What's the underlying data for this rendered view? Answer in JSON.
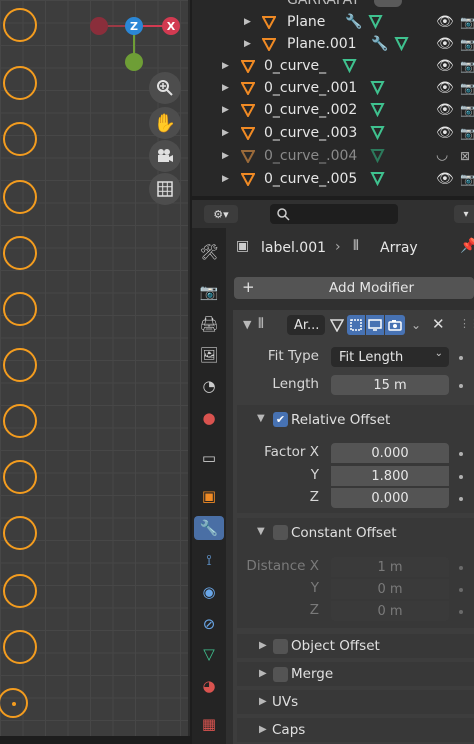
{
  "viewport": {
    "gizmo": {
      "x_label": "X",
      "z_label": "Z"
    },
    "nav_buttons": [
      "zoom-icon",
      "hand-pan-icon",
      "camera-icon",
      "grid-icon"
    ]
  },
  "outliner": {
    "rows": [
      {
        "name": "GARRAFAT",
        "dim": false
      },
      {
        "name": "Plane",
        "dim": false
      },
      {
        "name": "Plane.001",
        "dim": false
      },
      {
        "name": "0_curve_",
        "dim": false
      },
      {
        "name": "0_curve_.001",
        "dim": false
      },
      {
        "name": "0_curve_.002",
        "dim": false
      },
      {
        "name": "0_curve_.003",
        "dim": false
      },
      {
        "name": "0_curve_.004",
        "dim": true
      },
      {
        "name": "0_curve_.005",
        "dim": false
      }
    ]
  },
  "properties": {
    "breadcrumb": {
      "object": "label.001",
      "modifier": "Array"
    },
    "add_modifier": "Add Modifier",
    "modifier": {
      "name": "Ar...",
      "fit_type_label": "Fit Type",
      "fit_type_value": "Fit Length",
      "length_label": "Length",
      "length_value": "15 m",
      "relative_offset": {
        "label": "Relative Offset",
        "enabled": true,
        "factor_x_label": "Factor X",
        "factor_x": "0.000",
        "y_label": "Y",
        "y": "1.800",
        "z_label": "Z",
        "z": "0.000"
      },
      "constant_offset": {
        "label": "Constant Offset",
        "enabled": false,
        "distance_x_label": "Distance X",
        "distance_x": "1 m",
        "y_label": "Y",
        "y": "0 m",
        "z_label": "Z",
        "z": "0 m"
      },
      "object_offset": "Object Offset",
      "merge": "Merge",
      "uvs": "UVs",
      "caps": "Caps"
    }
  },
  "colors": {
    "curve_orange": "#f39c1f",
    "active_tab": "#4a6fa5",
    "checkbox_on": "#4772b3",
    "mod_icon_green": "#3fc28f",
    "wrench_blue": "#6aa7e8"
  }
}
